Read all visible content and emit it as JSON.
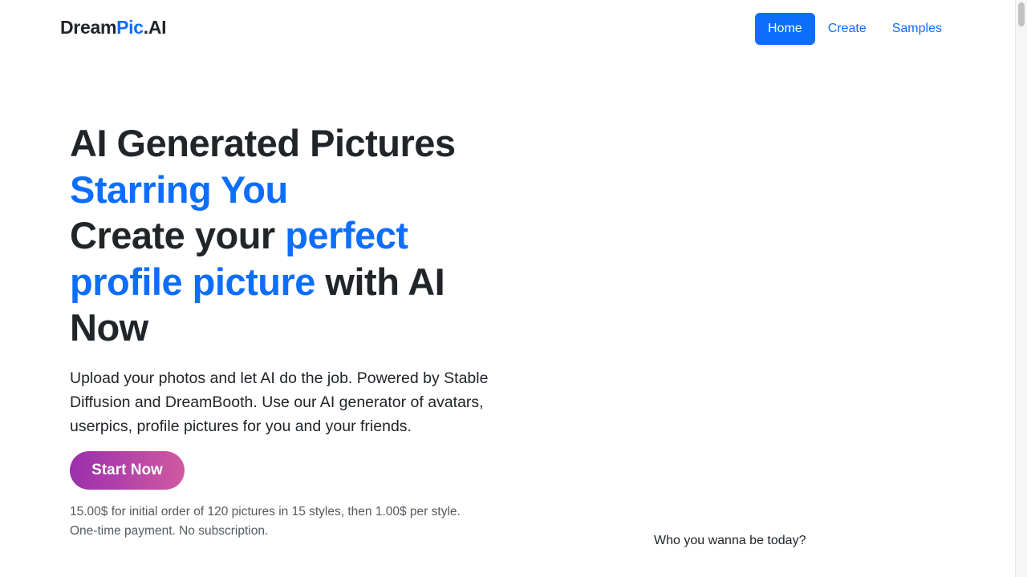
{
  "brand": {
    "part1": "Dream",
    "part2": "Pic",
    "part3": ".AI"
  },
  "nav": {
    "items": [
      {
        "label": "Home",
        "active": true
      },
      {
        "label": "Create",
        "active": false
      },
      {
        "label": "Samples",
        "active": false
      }
    ]
  },
  "hero": {
    "line1": "AI Generated Pictures",
    "line2": "Starring You",
    "line3a": "Create your ",
    "line3b": "perfect",
    "line4a": "profile picture",
    "line4b": " with AI",
    "line5": "Now",
    "lead": "Upload your photos and let AI do the job. Powered by Stable Diffusion and DreamBooth. Use our AI generator of avatars, userpics, profile pictures for you and your friends.",
    "cta_label": "Start Now",
    "pricing_line1": "15.00$ for initial order of 120 pictures in 15 styles, then 1.00$ per style.",
    "pricing_line2": "One-time payment. No subscription."
  },
  "side": {
    "caption": "Who you wanna be today?"
  },
  "colors": {
    "accent": "#0d6efd",
    "text": "#212529",
    "cta_gradient_start": "#9b2fae",
    "cta_gradient_end": "#cf5aa0"
  }
}
